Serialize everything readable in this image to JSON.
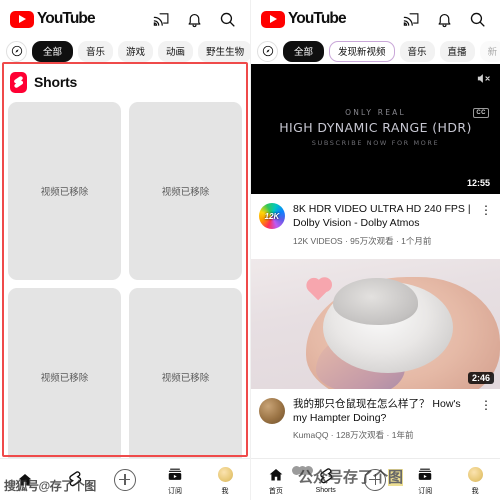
{
  "app": {
    "logo_text": "YouTube"
  },
  "top_actions": [
    "cast-icon",
    "bell-icon",
    "search-icon"
  ],
  "left_pane": {
    "chips": [
      {
        "label": "",
        "icon": "compass-icon",
        "style": "compass"
      },
      {
        "label": "全部",
        "style": "active"
      },
      {
        "label": "音乐",
        "style": "plain"
      },
      {
        "label": "游戏",
        "style": "plain"
      },
      {
        "label": "动画",
        "style": "plain"
      },
      {
        "label": "野生生物",
        "style": "plain"
      }
    ],
    "shelf": {
      "title": "Shorts",
      "icon": "shorts-icon",
      "cards": [
        {
          "label": "视频已移除"
        },
        {
          "label": "视频已移除"
        },
        {
          "label": "视频已移除"
        },
        {
          "label": "视频已移除"
        }
      ]
    },
    "bottom_nav": [
      {
        "label": "",
        "icon": "home-icon"
      },
      {
        "label": "",
        "icon": "shorts-icon"
      },
      {
        "label": "",
        "icon": "plus-icon"
      },
      {
        "label": "订阅",
        "icon": "subscriptions-icon"
      },
      {
        "label": "我",
        "icon": "avatar-icon"
      }
    ],
    "watermark": "搜狐号@存了个图"
  },
  "right_pane": {
    "chips": [
      {
        "label": "",
        "icon": "compass-icon",
        "style": "compass"
      },
      {
        "label": "全部",
        "style": "active"
      },
      {
        "label": "发现新视频",
        "style": "outline"
      },
      {
        "label": "音乐",
        "style": "plain"
      },
      {
        "label": "直播",
        "style": "plain"
      },
      {
        "label": "新",
        "style": "faded"
      }
    ],
    "videos": [
      {
        "thumb_kind": "hdr-dark",
        "overlay_line1": "ONLY REAL",
        "overlay_line2": "HIGH DYNAMIC RANGE (HDR)",
        "overlay_line3": "SUBSCRIBE NOW FOR MORE",
        "mute_icon": "muted-speaker-icon",
        "cc_badge": "CC",
        "duration": "12:55",
        "avatar_text": "12K",
        "title": "8K HDR VIDEO ULTRA HD 240 FPS | Dolby Vision - Dolby Atmos",
        "subtitle": "12K VIDEOS · 95万次观看 · 1个月前",
        "menu": "⋮"
      },
      {
        "thumb_kind": "hamster-photo",
        "duration": "2:46",
        "avatar_text": "",
        "title": "我的那只仓鼠现在怎么样了？ How's my Hampter Doing?",
        "subtitle": "KumaQQ · 128万次观看 · 1年前",
        "menu": "⋮"
      }
    ],
    "bottom_nav": [
      {
        "label": "首页",
        "icon": "home-icon"
      },
      {
        "label": "Shorts",
        "icon": "shorts-icon"
      },
      {
        "label": "",
        "icon": "plus-icon"
      },
      {
        "label": "订阅",
        "icon": "subscriptions-icon"
      },
      {
        "label": "我",
        "icon": "avatar-icon"
      }
    ],
    "watermark_prefix": "公众号",
    "watermark_mid": "存了个",
    "watermark_hl": "图"
  },
  "annotation": {
    "color": "#ef4a4a",
    "shape": "rectangle-highlight"
  }
}
